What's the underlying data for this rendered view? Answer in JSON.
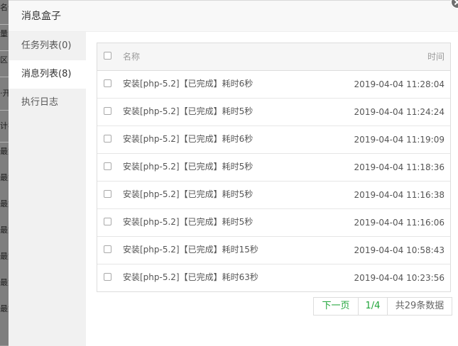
{
  "background": {
    "partial_labels": [
      "名位",
      "量·",
      "区(",
      "·开",
      "计补",
      "最如",
      "最如",
      "最如",
      "最如",
      "最如",
      "最如",
      "最如"
    ]
  },
  "dialog": {
    "title": "消息盒子",
    "close_icon": "close-icon"
  },
  "sidebar": {
    "items": [
      {
        "label": "任务列表(0)",
        "active": false
      },
      {
        "label": "消息列表(8)",
        "active": true
      },
      {
        "label": "执行日志",
        "active": false
      }
    ]
  },
  "table": {
    "header": {
      "name": "名称",
      "time": "时间"
    },
    "rows": [
      {
        "name": "安装[php-5.2]【已完成】耗时6秒",
        "time": "2019-04-04 11:28:04"
      },
      {
        "name": "安装[php-5.2]【已完成】耗时5秒",
        "time": "2019-04-04 11:24:24"
      },
      {
        "name": "安装[php-5.2]【已完成】耗时6秒",
        "time": "2019-04-04 11:19:09"
      },
      {
        "name": "安装[php-5.2]【已完成】耗时5秒",
        "time": "2019-04-04 11:18:36"
      },
      {
        "name": "安装[php-5.2]【已完成】耗时5秒",
        "time": "2019-04-04 11:16:38"
      },
      {
        "name": "安装[php-5.2]【已完成】耗时5秒",
        "time": "2019-04-04 11:16:06"
      },
      {
        "name": "安装[php-5.2]【已完成】耗时15秒",
        "time": "2019-04-04 10:58:43"
      },
      {
        "name": "安装[php-5.2]【已完成】耗时63秒",
        "time": "2019-04-04 10:23:56"
      }
    ]
  },
  "pager": {
    "next_label": "下一页",
    "current": "1/4",
    "total": "共29条数据"
  },
  "colors": {
    "accent": "#20a53a",
    "sidebar_bg": "#f1f1f1",
    "header_bg": "#f6f6f6"
  }
}
